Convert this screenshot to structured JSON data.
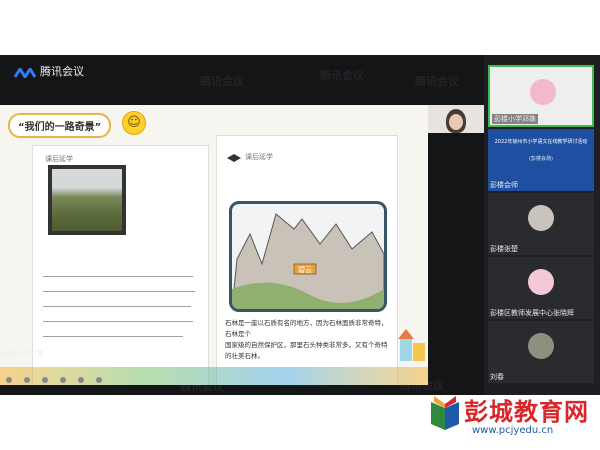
{
  "app": {
    "title": "腾讯会议",
    "watermark": "腾讯会议"
  },
  "slide": {
    "title": "“我们的一路奇景”",
    "left_page_heading": "课后延学",
    "right_page_heading": "课后延学",
    "drawing_label": "碧云",
    "handwriting_right": [
      "石林是一座以石质有名的地方，因为石林面质非常奇特，石林是个",
      "国家级的自然保护区，那里石头种类非常多，又有个奇特的壮美石林。"
    ]
  },
  "local_video": {
    "name": "彭楼小学邓姝"
  },
  "participants": [
    {
      "name": "彭楼小学邓姝",
      "kind": "avatar"
    },
    {
      "name": "彭楼会师",
      "kind": "slide",
      "slide_title": "2022年徐州市小学语文在线教学研讨活动",
      "slide_sub": "(彭楼会场)"
    },
    {
      "name": "彭楼张楚",
      "kind": "avatar"
    },
    {
      "name": "彭楼区教师发展中心张晓辉",
      "kind": "avatar"
    },
    {
      "name": "刘春",
      "kind": "avatar"
    }
  ],
  "site_logo": {
    "name": "彭城教育网",
    "url": "www.pcjyedu.cn"
  },
  "colors": {
    "accent": "#d9262b",
    "link": "#1e5aa8"
  }
}
